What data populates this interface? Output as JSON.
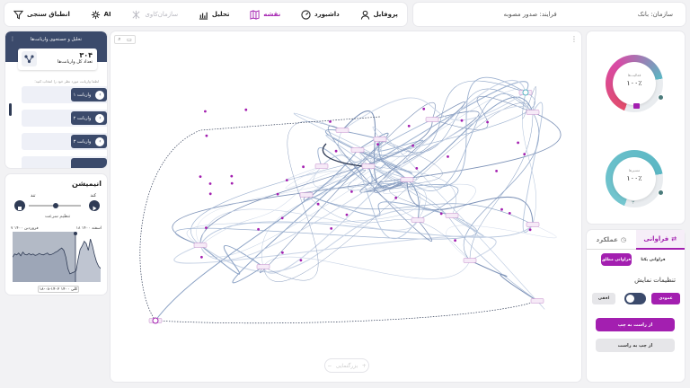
{
  "nav": {
    "items": [
      {
        "label": "پروفایل",
        "icon": "user-icon",
        "state": "normal"
      },
      {
        "label": "داشبورد",
        "icon": "dashboard-icon",
        "state": "normal"
      },
      {
        "label": "نقشه",
        "icon": "map-icon",
        "state": "active"
      },
      {
        "label": "تحلیل",
        "icon": "analysis-icon",
        "state": "normal"
      },
      {
        "label": "سازمان‌کاوی",
        "icon": "org-mining-icon",
        "state": "disabled"
      },
      {
        "label": "AI",
        "icon": "ai-icon",
        "state": "normal"
      },
      {
        "label": "انطباق سنجی",
        "icon": "filter-icon",
        "state": "normal"
      }
    ]
  },
  "info": {
    "organization": "سازمان: بانک",
    "process": "فرایند: صدور مصوبه"
  },
  "variants": {
    "title": "تحلیل و جستجوی واریانت‌ها",
    "count": "۳۰۴",
    "count_label": "تعداد کل واریانت‌ها",
    "hint": "لطفا واریانت مورد نظر خود را انتخاب کنید:",
    "items": [
      "واریانت ۱",
      "واریانت ۲",
      "واریانت ۳"
    ]
  },
  "animation": {
    "title": "انیمیشن",
    "slow": "کند",
    "fast": "تند",
    "speed_label": "تنظیم سرعت",
    "start_date": "۱۸ اسفند ۱۴۰۰",
    "end_date": "۷ فروردین ۱۴۰۰",
    "current_date": "۱۸-۰۸-۱۴۰۲ کلی ۱۴۰۰",
    "histogram": [
      0.55,
      0.62,
      0.6,
      0.64,
      0.58,
      0.66,
      0.61,
      0.6,
      0.63,
      0.6,
      0.62,
      0.59,
      0.6,
      0.63,
      0.61,
      0.6,
      0.62,
      0.64,
      0.6,
      0.61,
      0.63,
      0.66,
      0.68,
      0.72,
      0.75,
      0.7,
      0.55,
      0.3,
      0.18,
      0.2,
      0.22,
      0.25,
      0.5,
      0.72,
      0.8,
      0.9,
      0.85,
      0.7,
      0.95,
      0.8,
      0.6,
      0.45,
      0.35,
      0.3
    ]
  },
  "map": {
    "zoom_label": "بزرگنمایی"
  },
  "gauges": {
    "top_label": "فعالیت‌ها",
    "top_value": "۱۰۰٪",
    "caption": "تنظیم جزئیات",
    "bottom_label": "مسیرها",
    "bottom_value": "۱۰۰٪"
  },
  "settings": {
    "tab_frequency": "فراوانی",
    "tab_performance": "عملکرد",
    "pill_absolute": "فراوانی مطلق",
    "pill_unique": "فراوانی یکتا",
    "section_title": "تنظیمات نمایش",
    "vertical": "عمودی",
    "horizontal": "افقی",
    "rtl": "از راست به چپ",
    "ltr": "از چپ به راست"
  },
  "colors": {
    "accent": "#a31fb0",
    "navy": "#3b4a6b",
    "teal": "#4a7a7a"
  }
}
